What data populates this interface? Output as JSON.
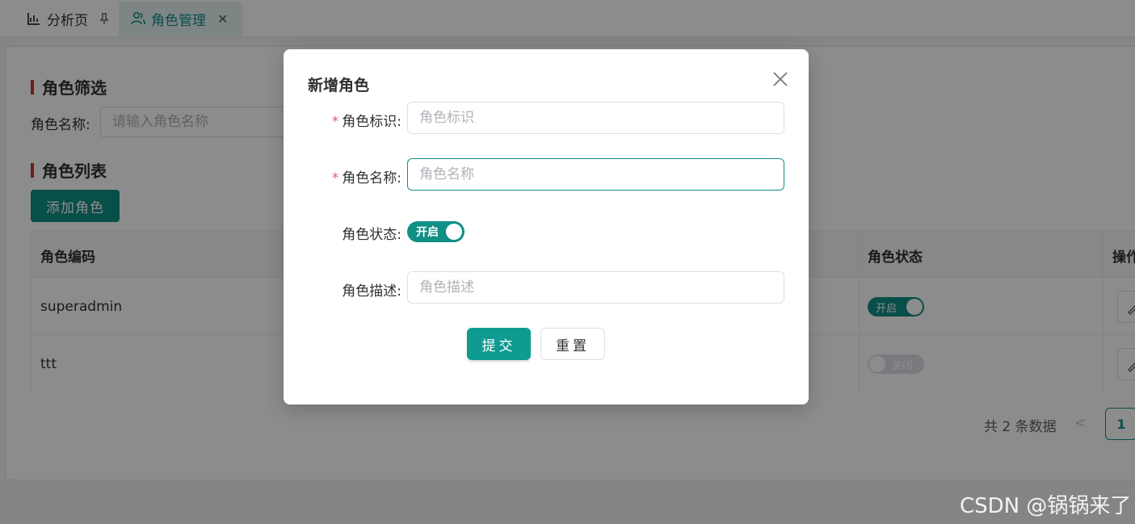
{
  "tabs": [
    {
      "label": "分析页",
      "icon": "chart-icon",
      "pinned": true
    },
    {
      "label": "角色管理",
      "icon": "user-group-icon",
      "active": true,
      "closable": true
    }
  ],
  "filter": {
    "section_title": "角色筛选",
    "label": "角色名称:",
    "placeholder": "请输入角色名称"
  },
  "list": {
    "section_title": "角色列表",
    "add_button": "添加角色",
    "columns": [
      "角色编码",
      "角色状态",
      "操作"
    ],
    "rows": [
      {
        "code": "superadmin",
        "status": "开启"
      },
      {
        "code": "ttt",
        "status": "关闭"
      }
    ]
  },
  "pagination": {
    "total": "共 2 条数据",
    "prev": "<",
    "current": "1"
  },
  "dialog": {
    "title": "新增角色",
    "fields": [
      {
        "label": "角色标识:",
        "placeholder": "角色标识",
        "required": true
      },
      {
        "label": "角色名称:",
        "placeholder": "角色名称",
        "required": true
      },
      {
        "label": "角色状态:",
        "switch_text": "开启",
        "value": true
      },
      {
        "label": "角色描述:",
        "placeholder": "角色描述",
        "required": false
      }
    ],
    "required_mark": "*",
    "submit": "提交",
    "reset": "重置",
    "close": "×"
  },
  "watermark": "CSDN @锅锅来了",
  "colors": {
    "primary": "#0f8f86",
    "required": "#e05a6b",
    "accent_bar": "#c0392b"
  }
}
